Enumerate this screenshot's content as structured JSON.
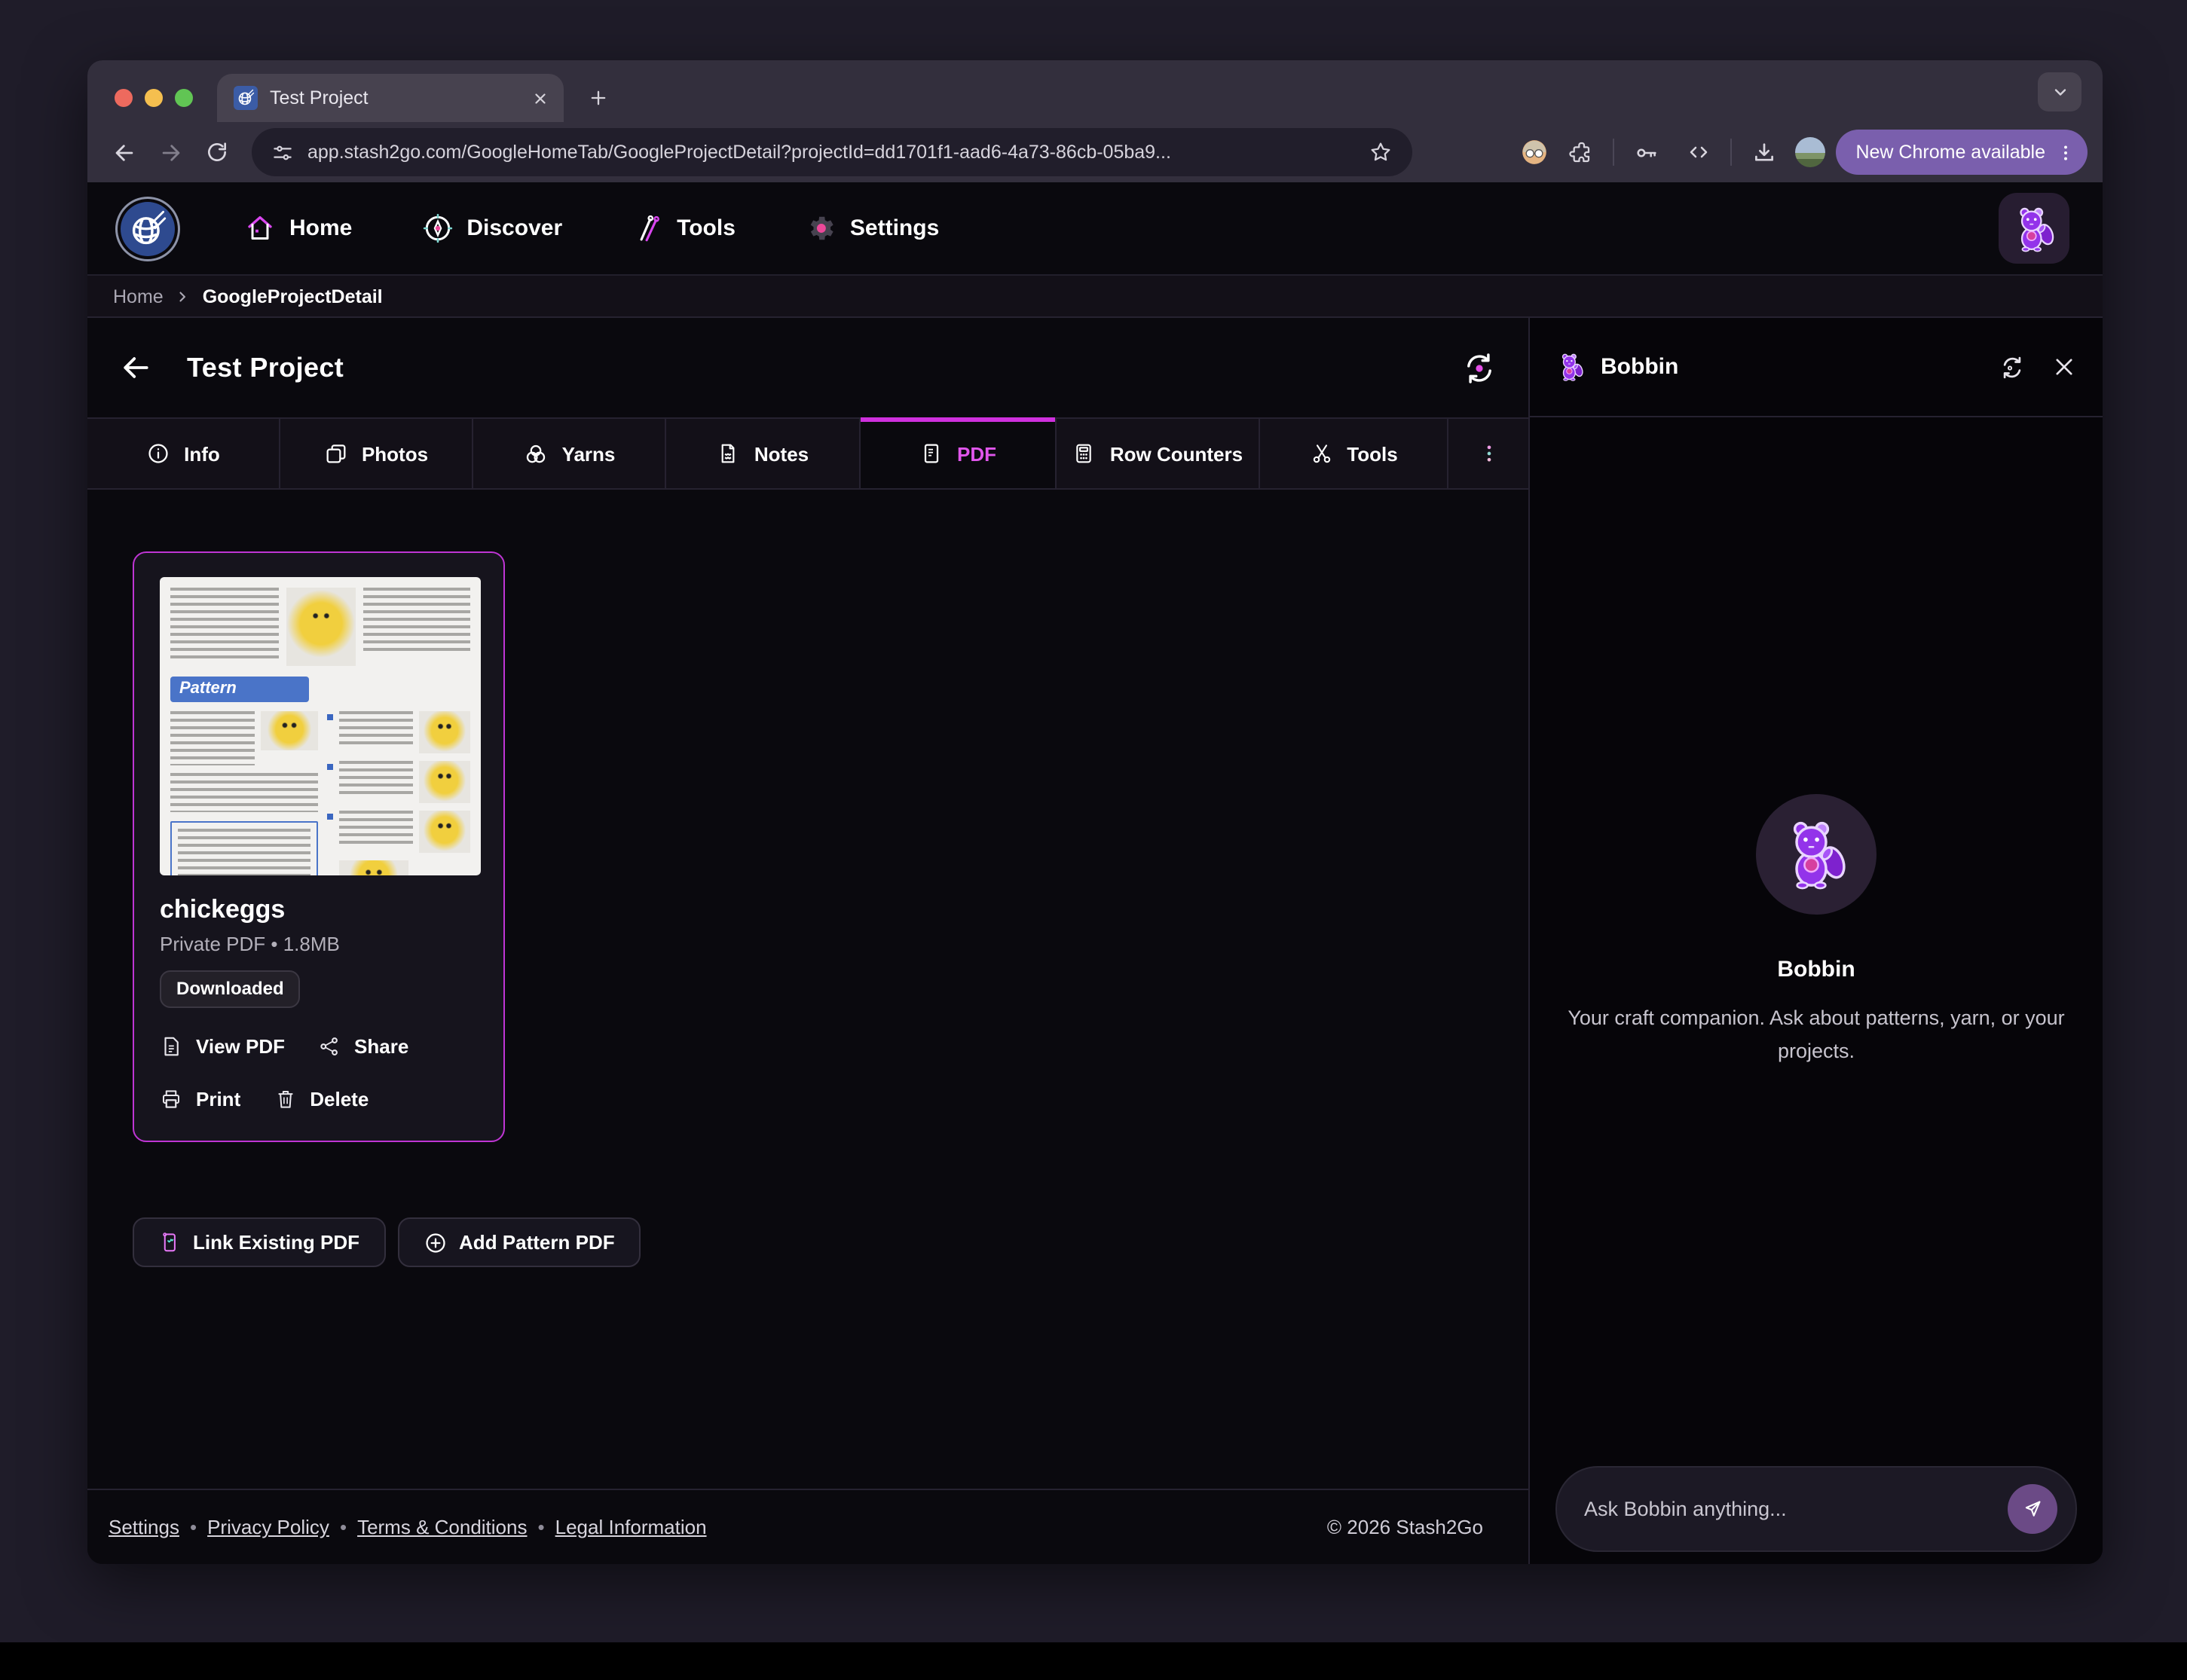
{
  "browser": {
    "tab_title": "Test Project",
    "url": "app.stash2go.com/GoogleHomeTab/GoogleProjectDetail?projectId=dd1701f1-aad6-4a73-86cb-05ba9...",
    "update_pill": "New Chrome available"
  },
  "nav": {
    "items": [
      {
        "label": "Home"
      },
      {
        "label": "Discover"
      },
      {
        "label": "Tools"
      },
      {
        "label": "Settings"
      }
    ]
  },
  "breadcrumb": {
    "root": "Home",
    "current": "GoogleProjectDetail"
  },
  "page": {
    "title": "Test Project"
  },
  "tabs": [
    {
      "label": "Info"
    },
    {
      "label": "Photos"
    },
    {
      "label": "Yarns"
    },
    {
      "label": "Notes"
    },
    {
      "label": "PDF",
      "active": true
    },
    {
      "label": "Row Counters"
    },
    {
      "label": "Tools"
    }
  ],
  "pdf_card": {
    "name": "chickeggs",
    "meta": "Private PDF • 1.8MB",
    "badge": "Downloaded",
    "actions": [
      {
        "label": "View PDF"
      },
      {
        "label": "Share"
      },
      {
        "label": "Print"
      },
      {
        "label": "Delete"
      }
    ],
    "thumbnail": {
      "heading": "Pattern"
    }
  },
  "pdf_actions": {
    "link_existing": "Link Existing PDF",
    "add_pattern": "Add Pattern PDF"
  },
  "bobbin": {
    "header_title": "Bobbin",
    "name": "Bobbin",
    "description": "Your craft companion. Ask about patterns, yarn, or your projects.",
    "input_placeholder": "Ask Bobbin anything..."
  },
  "footer": {
    "links": [
      {
        "label": "Settings"
      },
      {
        "label": "Privacy Policy"
      },
      {
        "label": "Terms & Conditions"
      },
      {
        "label": "Legal Information"
      }
    ],
    "separator": "•",
    "copyright": "© 2026 Stash2Go"
  },
  "colors": {
    "accent_magenta": "#cf30dd",
    "chrome_update_purple": "#7a5fad",
    "send_button_purple": "#6b4a86",
    "card_border": "#bf35d4"
  }
}
